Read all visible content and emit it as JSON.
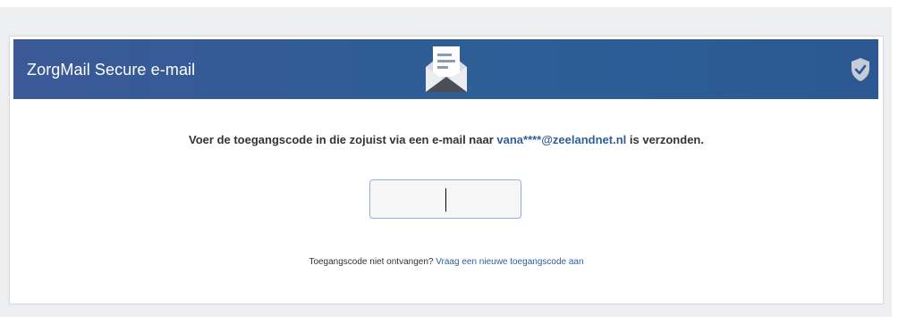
{
  "header": {
    "title": "ZorgMail Secure e-mail",
    "center_icon": "open-envelope-icon",
    "right_icon": "shield-check-icon"
  },
  "main": {
    "message_prefix": "Voer de toegangscode in die zojuist via een e-mail naar ",
    "email": "vana****@zeelandnet.nl",
    "message_suffix": " is verzonden.",
    "code_input_value": "",
    "not_received_text": "Toegangscode niet ontvangen? ",
    "resend_link": "Vraag een nieuwe toegangscode aan"
  },
  "colors": {
    "header_blue": "#2f5c95",
    "link_blue": "#2f5f9b",
    "page_background": "#eeeff1"
  }
}
